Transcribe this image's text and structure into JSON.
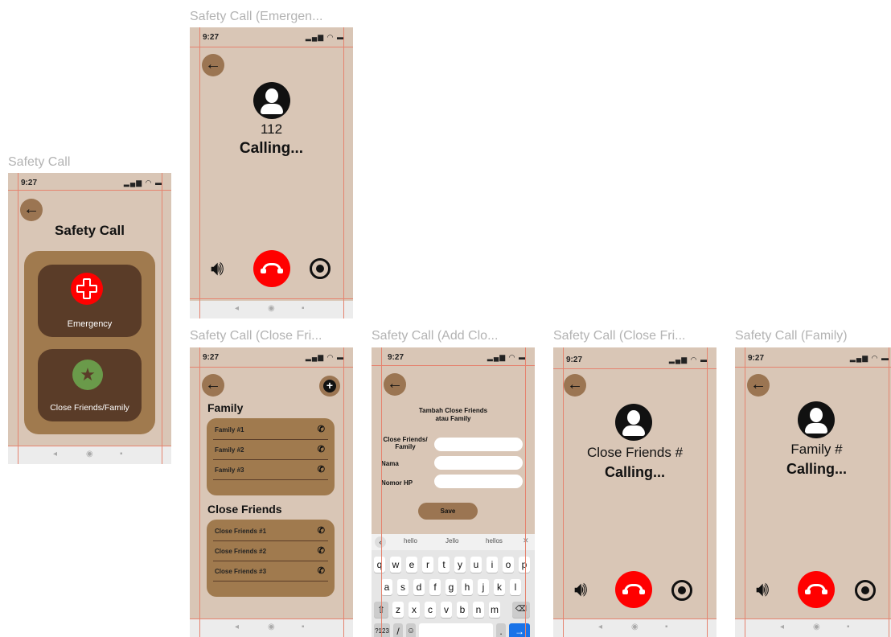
{
  "frames": {
    "main": {
      "label": "Safety Call",
      "title": "Safety Call",
      "time": "9:27",
      "emergency_label": "Emergency",
      "friends_label": "Close Friends/Family"
    },
    "emergency": {
      "label": "Safety Call (Emergen...",
      "time": "9:27",
      "number": "112",
      "status": "Calling..."
    },
    "list": {
      "label": "Safety Call (Close Fri...",
      "time": "9:27",
      "family_header": "Family",
      "family_items": [
        "Family #1",
        "Family #2",
        "Family #3"
      ],
      "friends_header": "Close Friends",
      "friends_items": [
        "Close Friends #1",
        "Close Friends #2",
        "Close Friends #3"
      ]
    },
    "add": {
      "label": "Safety Call (Add Clo...",
      "time": "9:27",
      "title_line1": "Tambah Close Friends",
      "title_line2": "atau Family",
      "field1_line1": "Close Friends/",
      "field1_line2": "Family",
      "field2": "Nama",
      "field3": "Nomor HP",
      "save": "Save",
      "suggestions": [
        "hello",
        "Jello",
        "hellos"
      ],
      "row1": [
        "q",
        "w",
        "e",
        "r",
        "t",
        "y",
        "u",
        "i",
        "o",
        "p"
      ],
      "row2": [
        "a",
        "s",
        "d",
        "f",
        "g",
        "h",
        "j",
        "k",
        "l"
      ],
      "row3": [
        "z",
        "x",
        "c",
        "v",
        "b",
        "n",
        "m"
      ],
      "key_123": "?123",
      "key_slash": "/",
      "key_dot": "."
    },
    "friend_call": {
      "label": "Safety Call (Close Fri...",
      "time": "9:27",
      "name": "Close Friends #",
      "status": "Calling..."
    },
    "family_call": {
      "label": "Safety Call (Family)",
      "time": "9:27",
      "name": "Family #",
      "status": "Calling..."
    }
  },
  "colors": {
    "bg": "#d9c6b6",
    "accent": "#a07a4e",
    "dark": "#5a3c28",
    "hangup": "#ff0000",
    "green": "#6a9a4a"
  }
}
